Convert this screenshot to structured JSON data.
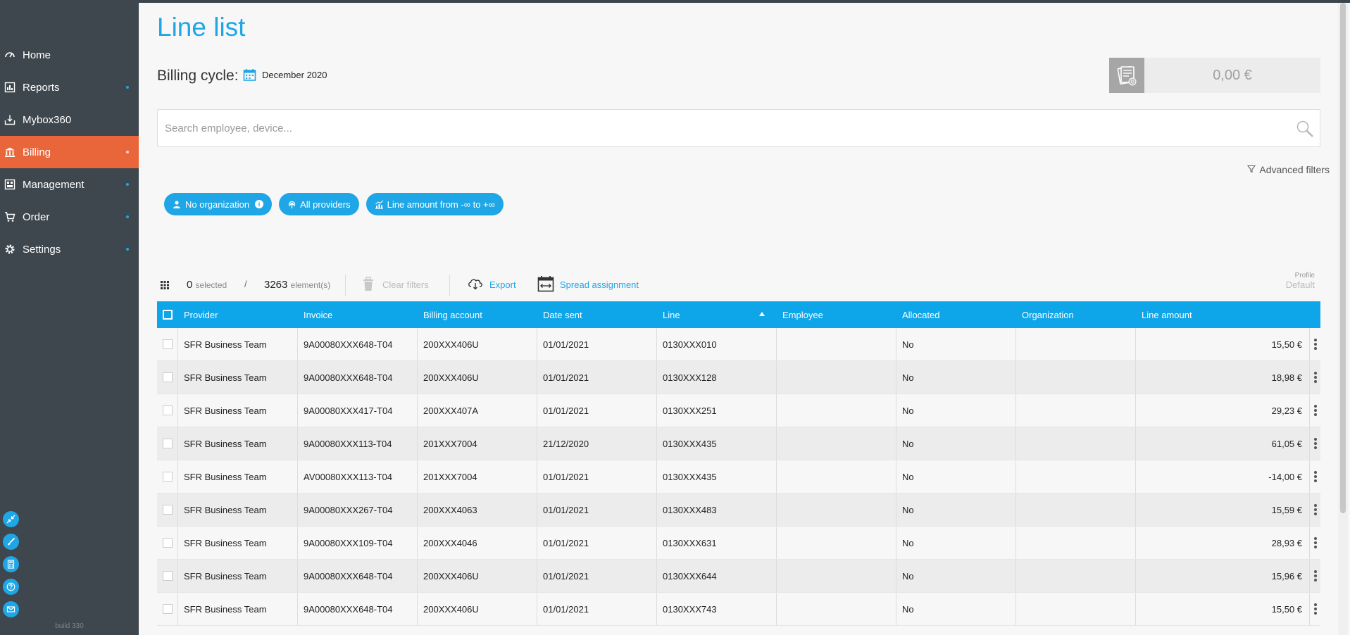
{
  "sidebar": {
    "items": [
      {
        "label": "Home",
        "icon": "speedometer-icon",
        "active": false,
        "has_children": false
      },
      {
        "label": "Reports",
        "icon": "chart-report-icon",
        "active": false,
        "has_children": true
      },
      {
        "label": "Mybox360",
        "icon": "inbox-download-icon",
        "active": false,
        "has_children": false
      },
      {
        "label": "Billing",
        "icon": "bank-icon",
        "active": true,
        "has_children": true
      },
      {
        "label": "Management",
        "icon": "management-grid-icon",
        "active": false,
        "has_children": true
      },
      {
        "label": "Order",
        "icon": "cart-icon",
        "active": false,
        "has_children": true
      },
      {
        "label": "Settings",
        "icon": "gear-icon",
        "active": false,
        "has_children": true
      }
    ],
    "tools": [
      "collapse-arrows-icon",
      "brush-icon",
      "calculator-icon",
      "help-icon",
      "mail-icon"
    ],
    "build": "build 330"
  },
  "header": {
    "title": "Line list",
    "billing_label": "Billing cycle:",
    "billing_value": "December 2020",
    "amount": "0,00 €",
    "amount_badge": "0"
  },
  "search": {
    "placeholder": "Search employee, device...",
    "value": ""
  },
  "advanced_filters": "Advanced filters",
  "chips": {
    "organization": "No organization",
    "providers": "All providers",
    "amount": "Line amount from -∞ to +∞"
  },
  "toolbar": {
    "selected_count": "0",
    "selected_label": "selected",
    "separator": "/",
    "total_count": "3263",
    "total_label": "element(s)",
    "clear_filters": "Clear filters",
    "export": "Export",
    "spread_assignment": "Spread assignment",
    "profile_label": "Profile",
    "profile_value": "Default"
  },
  "table": {
    "columns": [
      "Provider",
      "Invoice",
      "Billing account",
      "Date sent",
      "Line",
      "Employee",
      "Allocated",
      "Organization",
      "Line amount"
    ],
    "sorted_column": "Line",
    "rows": [
      [
        "SFR Business Team",
        "9A00080XXX648-T04",
        "200XXX406U",
        "01/01/2021",
        "0130XXX010",
        "",
        "No",
        "",
        "15,50 €"
      ],
      [
        "SFR Business Team",
        "9A00080XXX648-T04",
        "200XXX406U",
        "01/01/2021",
        "0130XXX128",
        "",
        "No",
        "",
        "18,98 €"
      ],
      [
        "SFR Business Team",
        "9A00080XXX417-T04",
        "200XXX407A",
        "01/01/2021",
        "0130XXX251",
        "",
        "No",
        "",
        "29,23 €"
      ],
      [
        "SFR Business Team",
        "9A00080XXX113-T04",
        "201XXX7004",
        "21/12/2020",
        "0130XXX435",
        "",
        "No",
        "",
        "61,05 €"
      ],
      [
        "SFR Business Team",
        "AV00080XXX113-T04",
        "201XXX7004",
        "01/01/2021",
        "0130XXX435",
        "",
        "No",
        "",
        "-14,00 €"
      ],
      [
        "SFR Business Team",
        "9A00080XXX267-T04",
        "200XXX4063",
        "01/01/2021",
        "0130XXX483",
        "",
        "No",
        "",
        "15,59 €"
      ],
      [
        "SFR Business Team",
        "9A00080XXX109-T04",
        "200XXX4046",
        "01/01/2021",
        "0130XXX631",
        "",
        "No",
        "",
        "28,93 €"
      ],
      [
        "SFR Business Team",
        "9A00080XXX648-T04",
        "200XXX406U",
        "01/01/2021",
        "0130XXX644",
        "",
        "No",
        "",
        "15,96 €"
      ],
      [
        "SFR Business Team",
        "9A00080XXX648-T04",
        "200XXX406U",
        "01/01/2021",
        "0130XXX743",
        "",
        "No",
        "",
        "15,50 €"
      ]
    ]
  },
  "colors": {
    "accent": "#1ea6e6",
    "active_nav": "#e8663a",
    "sidebar_bg": "#3f474e",
    "header_bg": "#0fa5e9"
  }
}
